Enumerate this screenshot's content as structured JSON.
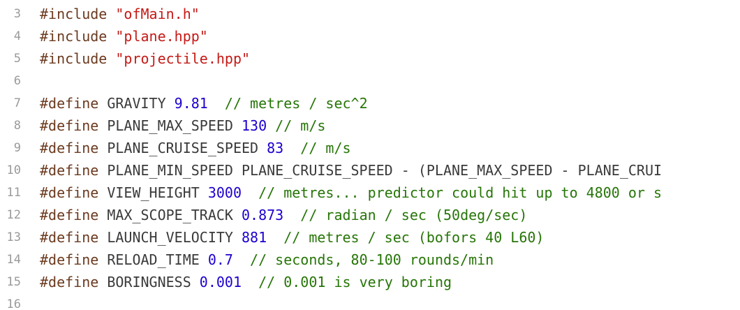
{
  "editor": {
    "lines": [
      {
        "num": "3",
        "tokens": [
          {
            "t": "#include ",
            "k": "directive"
          },
          {
            "t": "\"ofMain.h\"",
            "k": "string"
          }
        ]
      },
      {
        "num": "4",
        "tokens": [
          {
            "t": "#include ",
            "k": "directive"
          },
          {
            "t": "\"plane.hpp\"",
            "k": "string"
          }
        ]
      },
      {
        "num": "5",
        "tokens": [
          {
            "t": "#include ",
            "k": "directive"
          },
          {
            "t": "\"projectile.hpp\"",
            "k": "string"
          }
        ]
      },
      {
        "num": "6",
        "tokens": []
      },
      {
        "num": "7",
        "tokens": [
          {
            "t": "#define ",
            "k": "directive"
          },
          {
            "t": "GRAVITY ",
            "k": "plain"
          },
          {
            "t": "9.81",
            "k": "number"
          },
          {
            "t": "  // metres / sec^2",
            "k": "comment"
          }
        ]
      },
      {
        "num": "8",
        "tokens": [
          {
            "t": "#define ",
            "k": "directive"
          },
          {
            "t": "PLANE_MAX_SPEED ",
            "k": "plain"
          },
          {
            "t": "130",
            "k": "number"
          },
          {
            "t": " // m/s",
            "k": "comment"
          }
        ]
      },
      {
        "num": "9",
        "tokens": [
          {
            "t": "#define ",
            "k": "directive"
          },
          {
            "t": "PLANE_CRUISE_SPEED ",
            "k": "plain"
          },
          {
            "t": "83",
            "k": "number"
          },
          {
            "t": "  // m/s",
            "k": "comment"
          }
        ]
      },
      {
        "num": "10",
        "tokens": [
          {
            "t": "#define ",
            "k": "directive"
          },
          {
            "t": "PLANE_MIN_SPEED PLANE_CRUISE_SPEED - (PLANE_MAX_SPEED - PLANE_CRUI",
            "k": "plain"
          }
        ]
      },
      {
        "num": "11",
        "tokens": [
          {
            "t": "#define ",
            "k": "directive"
          },
          {
            "t": "VIEW_HEIGHT ",
            "k": "plain"
          },
          {
            "t": "3000",
            "k": "number"
          },
          {
            "t": "  // metres... predictor could hit up to 4800 or s",
            "k": "comment"
          }
        ]
      },
      {
        "num": "12",
        "tokens": [
          {
            "t": "#define ",
            "k": "directive"
          },
          {
            "t": "MAX_SCOPE_TRACK ",
            "k": "plain"
          },
          {
            "t": "0.873",
            "k": "number"
          },
          {
            "t": "  // radian / sec (50deg/sec)",
            "k": "comment"
          }
        ]
      },
      {
        "num": "13",
        "tokens": [
          {
            "t": "#define ",
            "k": "directive"
          },
          {
            "t": "LAUNCH_VELOCITY ",
            "k": "plain"
          },
          {
            "t": "881",
            "k": "number"
          },
          {
            "t": "  // metres / sec (bofors 40 L60)",
            "k": "comment"
          }
        ]
      },
      {
        "num": "14",
        "tokens": [
          {
            "t": "#define ",
            "k": "directive"
          },
          {
            "t": "RELOAD_TIME ",
            "k": "plain"
          },
          {
            "t": "0.7",
            "k": "number"
          },
          {
            "t": "  // seconds, 80-100 rounds/min",
            "k": "comment"
          }
        ]
      },
      {
        "num": "15",
        "tokens": [
          {
            "t": "#define ",
            "k": "directive"
          },
          {
            "t": "BORINGNESS ",
            "k": "plain"
          },
          {
            "t": "0.001",
            "k": "number"
          },
          {
            "t": "  // 0.001 is very boring",
            "k": "comment"
          }
        ]
      },
      {
        "num": "16",
        "tokens": []
      }
    ]
  },
  "colors": {
    "background": "#ffffff",
    "gutter_text": "#9a9a9a",
    "directive": "#6b3a1f",
    "plain": "#3a3a3a",
    "string": "#c41a16",
    "number": "#1c00cf",
    "comment": "#267507"
  }
}
